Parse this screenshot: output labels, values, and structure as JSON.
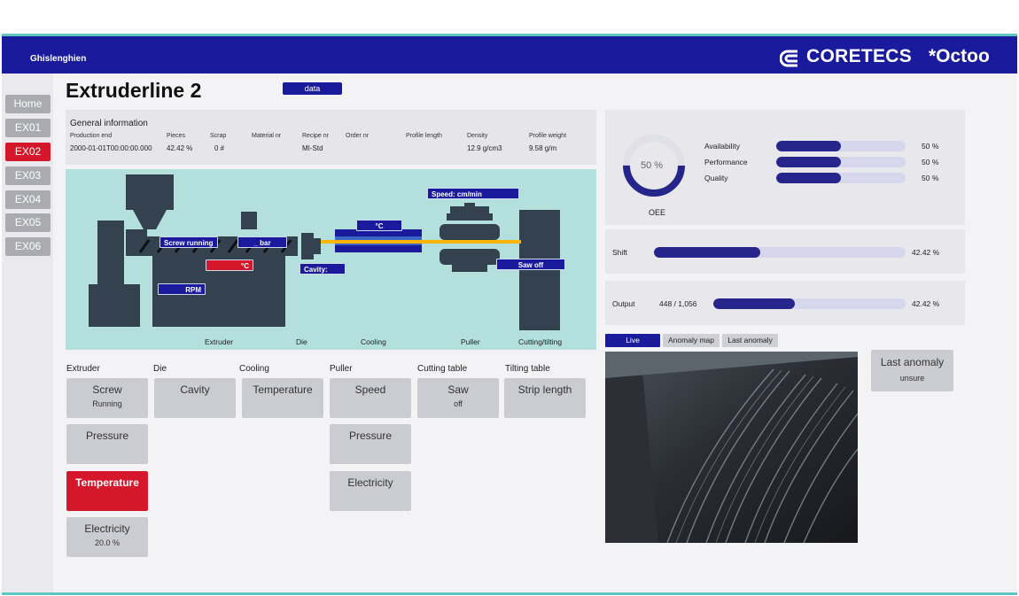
{
  "header": {
    "site": "Ghislenghien",
    "brand_primary": "CORETECS",
    "brand_secondary": "*Octoo"
  },
  "nav": [
    "Home",
    "EX01",
    "EX02",
    "EX03",
    "EX04",
    "EX05",
    "EX06"
  ],
  "nav_active": "EX02",
  "page": {
    "title": "Extruderline 2",
    "data_button": "data"
  },
  "general_info": {
    "title": "General information",
    "fields": [
      {
        "label": "Production end",
        "value": "2000-01-01T00:00:00.000"
      },
      {
        "label": "Pieces",
        "value": "42.42  %"
      },
      {
        "label": "Scrap",
        "value": "0  #"
      },
      {
        "label": "Material nr",
        "value": ""
      },
      {
        "label": "Recipe nr",
        "value": "MI-Std"
      },
      {
        "label": "Order nr",
        "value": ""
      },
      {
        "label": "Profile length",
        "value": ""
      },
      {
        "label": "Density",
        "value": "12.9  g/cm3"
      },
      {
        "label": "Profile weight",
        "value": "9.58  g/m"
      }
    ]
  },
  "diagram": {
    "tags": {
      "screw": "Screw running",
      "bar": "_ bar",
      "temp": "°C",
      "rpm": "RPM",
      "cavity": "Cavity:",
      "cooling_temp": "°C",
      "speed": "Speed:      cm/min",
      "saw": "Saw off"
    },
    "labels": [
      "Extruder",
      "Die",
      "Cooling",
      "Puller",
      "Cutting/tilting"
    ]
  },
  "sections": [
    "Extruder",
    "Die",
    "Cooling",
    "Puller",
    "Cutting table",
    "Tilting table"
  ],
  "tiles": {
    "extruder": [
      {
        "name": "Screw",
        "value": "Running",
        "alert": false
      },
      {
        "name": "Pressure",
        "value": "",
        "alert": false
      },
      {
        "name": "Temperature",
        "value": "",
        "alert": true
      },
      {
        "name": "Electricity",
        "value": "20.0 %",
        "alert": false
      }
    ],
    "die": [
      {
        "name": "Cavity",
        "value": ""
      }
    ],
    "cooling": [
      {
        "name": "Temperature",
        "value": ""
      }
    ],
    "puller": [
      {
        "name": "Speed",
        "value": ""
      },
      {
        "name": "Pressure",
        "value": ""
      },
      {
        "name": "Electricity",
        "value": ""
      }
    ],
    "cutting": [
      {
        "name": "Saw",
        "value": "off"
      }
    ],
    "tilting": [
      {
        "name": "Strip length",
        "value": ""
      }
    ]
  },
  "oee": {
    "gauge_text": "50 %",
    "gauge_value": 50,
    "label": "OEE",
    "metrics": [
      {
        "label": "Availability",
        "value": 50,
        "text": "50  %"
      },
      {
        "label": "Performance",
        "value": 50,
        "text": "50  %"
      },
      {
        "label": "Quality",
        "value": 50,
        "text": "50  %"
      }
    ]
  },
  "shift": {
    "label": "Shift",
    "value": 42.42,
    "text": "42.42  %"
  },
  "output": {
    "label": "Output",
    "count": "448  /  1,056",
    "value": 42.42,
    "text": "42.42  %"
  },
  "video_tabs": [
    "Live",
    "Anomaly map",
    "Last anomaly"
  ],
  "last_anomaly": {
    "title": "Last anomaly",
    "value": "unsure"
  },
  "colors": {
    "brand": "#1a1a9c",
    "alert": "#d4172a",
    "accent": "#5dc6c0",
    "diagram_bg": "#b3dfdc",
    "machine": "#34414f"
  }
}
